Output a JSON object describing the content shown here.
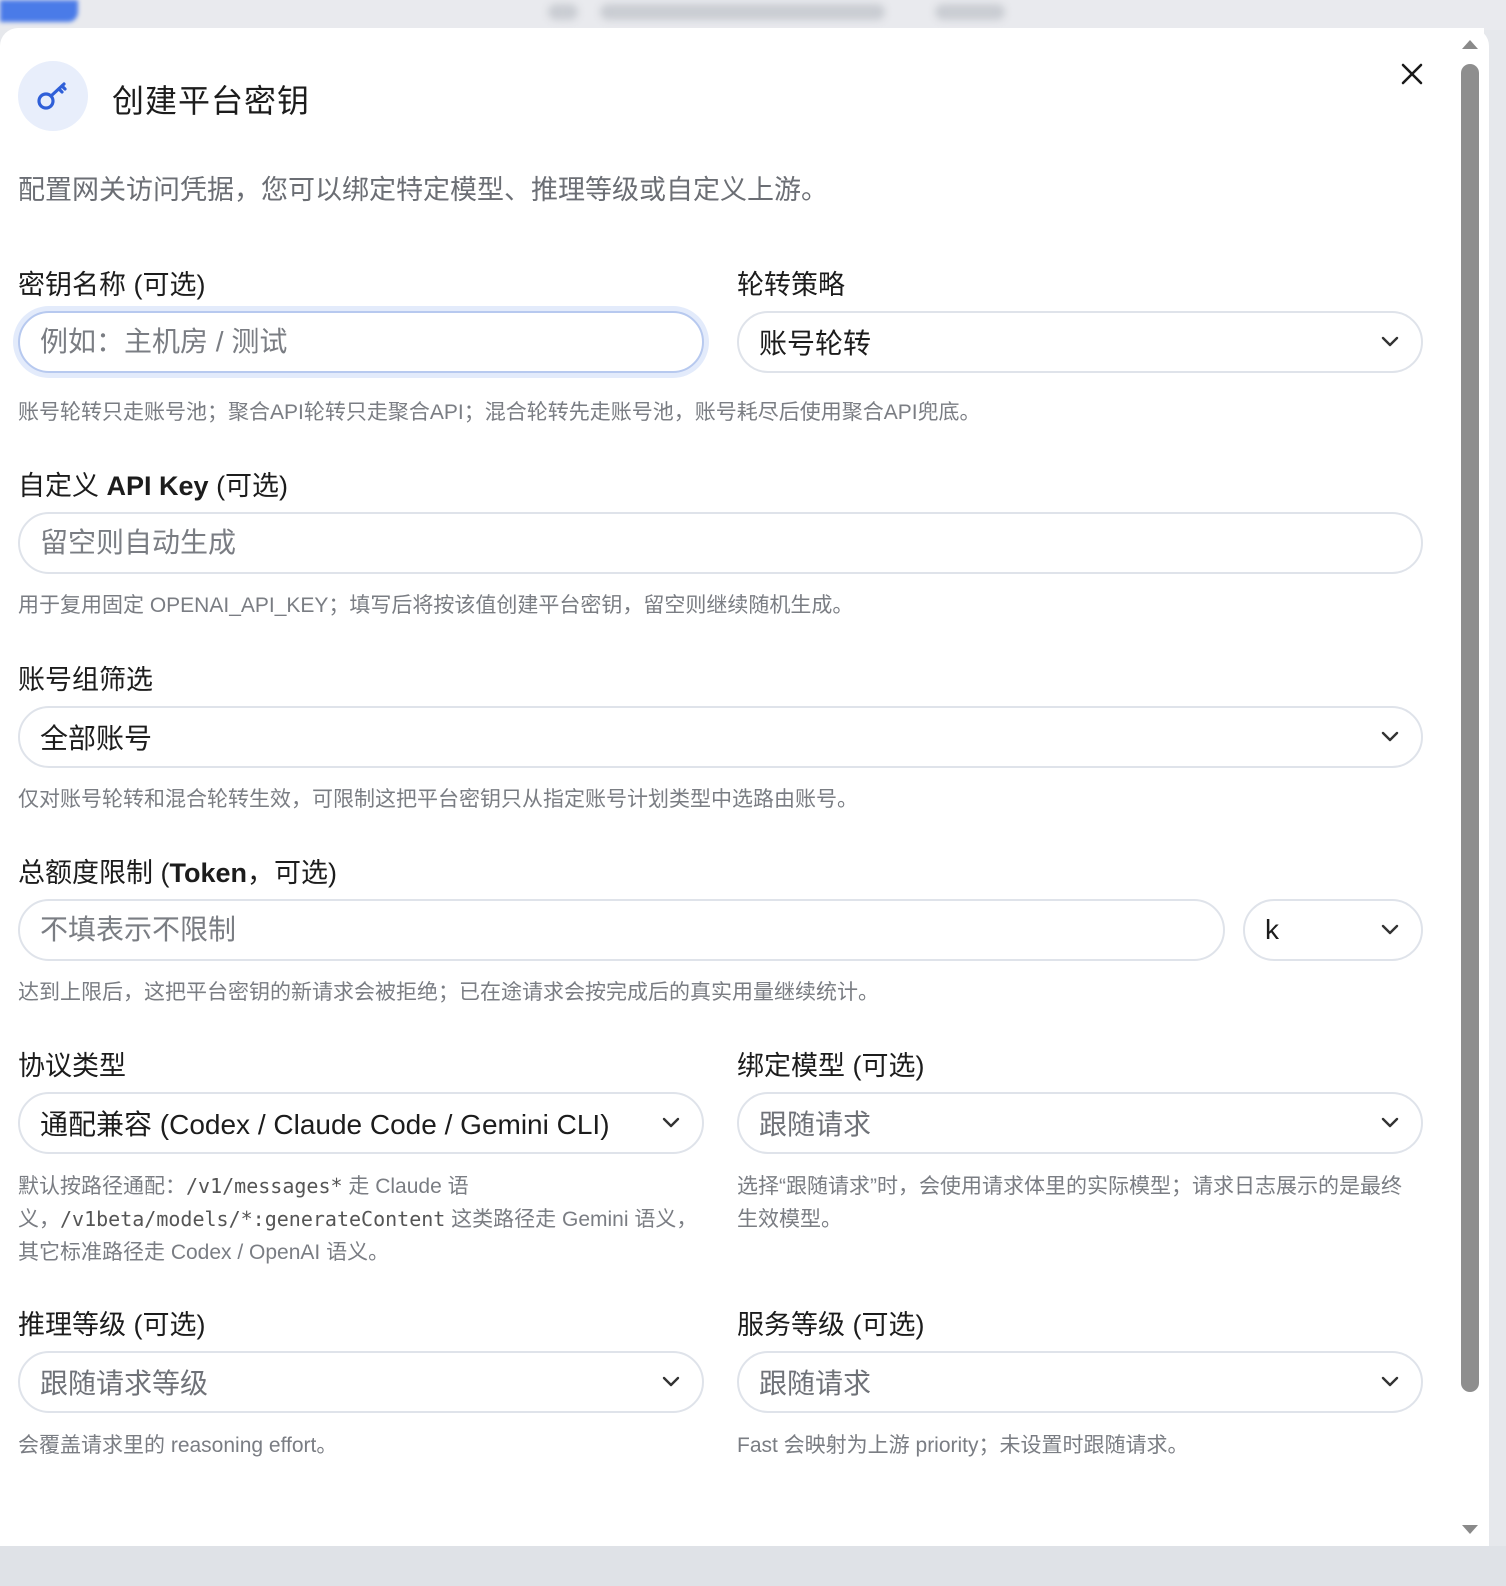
{
  "dialog": {
    "title": "创建平台密钥",
    "description": "配置网关访问凭据，您可以绑定特定模型、推理等级或自定义上游。",
    "icon": "key-icon",
    "close_icon": "close-icon"
  },
  "key_name": {
    "label": "密钥名称 (可选)",
    "placeholder": "例如：主机房 / 测试",
    "value": ""
  },
  "rotation_strategy": {
    "label": "轮转策略",
    "selected": "账号轮转"
  },
  "rotation_hint": "账号轮转只走账号池；聚合API轮转只走聚合API；混合轮转先走账号池，账号耗尽后使用聚合API兜底。",
  "custom_api_key": {
    "label_prefix": "自定义 ",
    "label_bold": "API Key",
    "label_suffix": " (可选)",
    "placeholder": "留空则自动生成",
    "hint": "用于复用固定 OPENAI_API_KEY；填写后将按该值创建平台密钥，留空则继续随机生成。"
  },
  "account_group": {
    "label": "账号组筛选",
    "selected": "全部账号",
    "hint": "仅对账号轮转和混合轮转生效，可限制这把平台密钥只从指定账号计划类型中选路由账号。"
  },
  "quota": {
    "label_prefix": "总额度限制 (",
    "label_bold": "Token",
    "label_suffix": "，可选)",
    "placeholder": "不填表示不限制",
    "unit_selected": "k",
    "hint": "达到上限后，这把平台密钥的新请求会被拒绝；已在途请求会按完成后的真实用量继续统计。"
  },
  "protocol": {
    "label": "协议类型",
    "selected": "通配兼容 (Codex / Claude Code / Gemini CLI)",
    "hint_1": "默认按路径通配：",
    "hint_code_1": "/v1/messages*",
    "hint_2": " 走 Claude 语",
    "hint_3": "义，",
    "hint_code_2": "/v1beta/models/*:generateContent",
    "hint_4": " 这类路径走 Gemini 语义，",
    "hint_5": "其它标准路径走 Codex / OpenAI 语义。"
  },
  "bound_model": {
    "label": "绑定模型 (可选)",
    "selected": "跟随请求",
    "hint": "选择“跟随请求”时，会使用请求体里的实际模型；请求日志展示的是最终生效模型。"
  },
  "reasoning_level": {
    "label": "推理等级 (可选)",
    "selected": "跟随请求等级",
    "hint": "会覆盖请求里的 reasoning effort。"
  },
  "service_tier": {
    "label": "服务等级 (可选)",
    "selected": "跟随请求",
    "hint": "Fast 会映射为上游 priority；未设置时跟随请求。"
  },
  "colors": {
    "accent": "#2f5fd8",
    "icon_bg": "#e8eefb",
    "border": "#dfe3ea",
    "muted_text": "#7a7d83"
  }
}
